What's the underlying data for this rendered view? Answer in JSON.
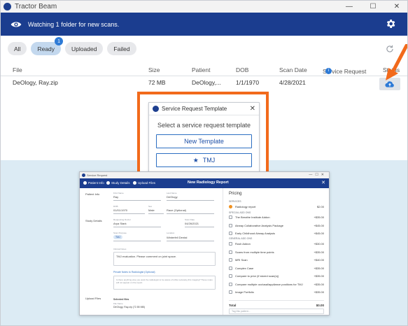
{
  "window": {
    "title": "Tractor Beam"
  },
  "header": {
    "message": "Watching 1 folder for new scans."
  },
  "filters": [
    {
      "label": "All"
    },
    {
      "label": "Ready",
      "badge": "1"
    },
    {
      "label": "Uploaded"
    },
    {
      "label": "Failed"
    }
  ],
  "table": {
    "columns": {
      "file": "File",
      "size": "Size",
      "patient": "Patient",
      "dob": "DOB",
      "scan_date": "Scan Date",
      "service_request": "Service Request",
      "status": "Status"
    },
    "rows": [
      {
        "file": "DeOlogy, Ray.zip",
        "size": "72 MB",
        "patient": "DeOlogy,...",
        "dob": "1/1/1970",
        "scan_date": "4/28/2021"
      }
    ]
  },
  "template_dialog": {
    "title": "Service Request Template",
    "prompt": "Select a service request template",
    "new_template": "New Template",
    "tmj": "TMJ"
  },
  "report": {
    "window_title": "Service Request",
    "steps": [
      "Patient Info",
      "Study Details",
      "Upload Files"
    ],
    "title": "New Radiology Report",
    "sections": {
      "patient_info": "Patient Info",
      "study_details": "Study Details",
      "upload_files": "Upload Files"
    },
    "fields": {
      "first_name_label": "First Name",
      "first_name": "Ray",
      "last_name_label": "Last Name",
      "last_name": "DeOlogy",
      "dob_label": "DOB",
      "dob": "01/01/1970",
      "sex_label": "Sex",
      "sex": "Male",
      "race_label": "Race (Optional)",
      "referring_doctor_label": "Requesting Doctor",
      "referring_doctor": "Arya Stark",
      "scan_date_label": "Scan Date",
      "scan_date": "04/26/2021",
      "scan_purpose_label": "Scan Purpose",
      "scan_purpose": "TMJ",
      "location_label": "Location",
      "location": "Winterfell Dental",
      "clinical_notes_label": "Clinical Notes",
      "clinical_notes": "TMJ evaluation. Please comment on joint space.",
      "private_notes_link": "Private Notes to Radiologist (Optional)",
      "private_notes_placeholder": "Is there anything else you want the radiologist to be aware of while reviewing this imaging? These notes will not appear on the report.",
      "selected_files_label": "Selected files",
      "file_name_label": "File Name",
      "file_name": "DeOlogy, Ray.zip (72.55 MB)"
    },
    "pricing": {
      "title": "Pricing",
      "services_label": "SERVICES",
      "services": [
        {
          "name": "Radiology report",
          "price": "$2.00",
          "checked": true
        }
      ],
      "special_label": "SPECIAL ADD ONS",
      "special": [
        {
          "name": "The Breathe Institute Addon",
          "price": "+$35.00"
        },
        {
          "name": "Airway Collaborative Analysis Package",
          "price": "+$45.00"
        },
        {
          "name": "Early Childhood Airway Analysis",
          "price": "+$45.00"
        }
      ],
      "general_label": "GENERAL ADD ONS",
      "general": [
        {
          "name": "Rush Addon",
          "price": "+$30.00"
        },
        {
          "name": "Scans from multiple time points",
          "price": "+$35.00"
        },
        {
          "name": "MRI Scan",
          "price": "+$40.00"
        },
        {
          "name": "Complex Case",
          "price": "+$35.00"
        },
        {
          "name": "Compare to prior (if stored scan(s))",
          "price": "+$35.00"
        },
        {
          "name": "Compare multiple occlusal/appliance positions for TMJ",
          "price": "+$35.00"
        },
        {
          "name": "Image Portfolio",
          "price": "+$35.00"
        }
      ],
      "total_label": "Total",
      "total": "$0.00",
      "tag_placeholder": "Tag this patient..."
    }
  },
  "colors": {
    "header": "#1b3d8f",
    "accent": "#2d7ad6",
    "highlight": "#f26a1b"
  }
}
